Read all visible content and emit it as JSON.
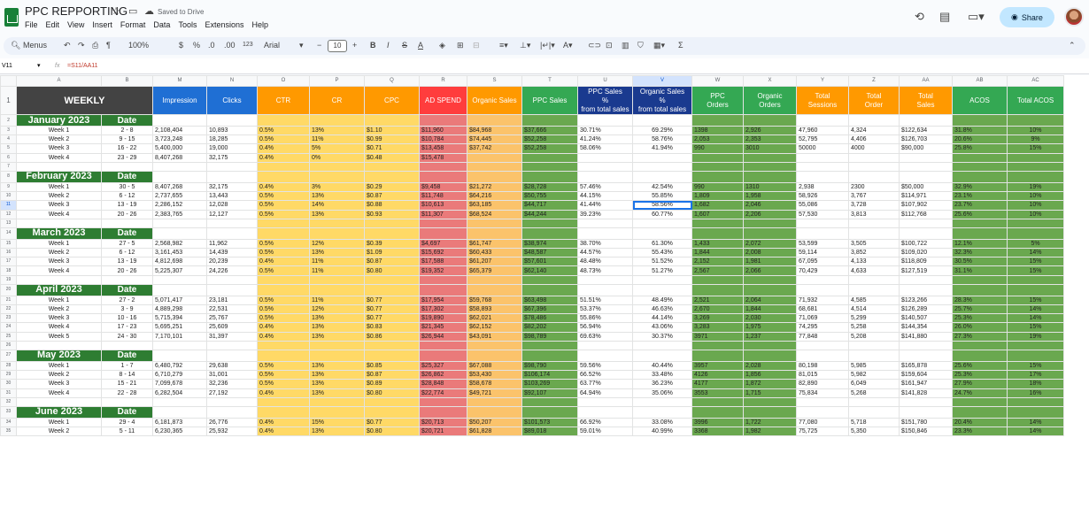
{
  "app": {
    "doc_title": "PPC REPPORTING",
    "saved_status": "Saved to Drive",
    "menus": [
      "File",
      "Edit",
      "View",
      "Insert",
      "Format",
      "Data",
      "Tools",
      "Extensions",
      "Help"
    ],
    "share_label": "Share"
  },
  "toolbar": {
    "menus_label": "Menus",
    "zoom": "100%",
    "currency": "$",
    "percent": "%",
    "decimal_dec": ".0",
    "decimal_inc": ".00",
    "number_format": "123",
    "font": "Arial",
    "font_size": "10"
  },
  "formula_bar": {
    "cell_ref": "V11",
    "fx": "fx",
    "formula": "=S11/AA11"
  },
  "columns": [
    "A",
    "B",
    "M",
    "N",
    "O",
    "P",
    "Q",
    "R",
    "S",
    "T",
    "U",
    "V",
    "W",
    "X",
    "Y",
    "Z",
    "AA",
    "AB",
    "AC"
  ],
  "selected_column": "V",
  "header_row": {
    "row_number": "1",
    "cells": [
      "WEEKLY",
      "",
      "Impression",
      "Clicks",
      "CTR",
      "CR",
      "CPC",
      "AD SPEND",
      "Organic Sales",
      "PPC Sales",
      "PPC Sales\n%\nfrom total sales",
      "Organic Sales\n%\nfrom total sales",
      "PPC\nOrders",
      "Organic\nOrders",
      "Total\nSessions",
      "Total\nOrder",
      "Total\nSales",
      "ACOS",
      "Total ACOS"
    ]
  },
  "colors": {
    "header_dark": "#434343",
    "header_blue": "#1f6fd4",
    "header_orange": "#ff9900",
    "header_red": "#ff3d3d",
    "header_green": "#34a853",
    "header_navy": "#1a3a8f",
    "month_green": "#2e7d32",
    "col_yellow": "#ffd966",
    "col_pink": "#ea7a7a",
    "col_light_orange": "#fbc36b",
    "col_green": "#6aa84f",
    "selected": "#d3e3fd"
  },
  "rows": [
    {
      "n": "2",
      "type": "month",
      "name": "January 2023",
      "date_label": "Date"
    },
    {
      "n": "3",
      "cells": [
        "Week 1",
        "2 - 8",
        "2,108,404",
        "10,893",
        "0.5%",
        "13%",
        "$1.10",
        "$11,960",
        "$84,968",
        "$37,666",
        "30.71%",
        "69.29%",
        "1398",
        "2,926",
        "47,960",
        "4,324",
        "$122,634",
        "31.8%",
        "10%"
      ]
    },
    {
      "n": "4",
      "cells": [
        "Week 2",
        "9 - 15",
        "3,723,248",
        "18,285",
        "0.5%",
        "11%",
        "$0.99",
        "$10,784",
        "$74,445",
        "$52,258",
        "41.24%",
        "58.76%",
        "2,053",
        "2,353",
        "52,795",
        "4,406",
        "$126,703",
        "20.6%",
        "9%"
      ]
    },
    {
      "n": "5",
      "cells": [
        "Week 3",
        "16 - 22",
        "5,400,000",
        "19,000",
        "0.4%",
        "5%",
        "$0.71",
        "$13,458",
        "$37,742",
        "$52,258",
        "58.06%",
        "41.94%",
        "990",
        "3010",
        "50000",
        "4000",
        "$90,000",
        "25.8%",
        "15%"
      ]
    },
    {
      "n": "6",
      "cells": [
        "Week 4",
        "23 - 29",
        "8,407,268",
        "32,175",
        "0.4%",
        "0%",
        "$0.48",
        "$15,478",
        "",
        "",
        "",
        "",
        "",
        "",
        "",
        "",
        "",
        "",
        ""
      ]
    },
    {
      "n": "7",
      "type": "blank"
    },
    {
      "n": "8",
      "type": "month",
      "name": "February 2023",
      "date_label": "Date"
    },
    {
      "n": "9",
      "cells": [
        "Week 1",
        "30 - 5",
        "8,407,268",
        "32,175",
        "0.4%",
        "3%",
        "$0.29",
        "$9,458",
        "$21,272",
        "$28,728",
        "57.46%",
        "42.54%",
        "990",
        "1310",
        "2,938",
        "2300",
        "$50,000",
        "32.9%",
        "19%"
      ]
    },
    {
      "n": "10",
      "cells": [
        "Week 2",
        "6 - 12",
        "2,737,655",
        "13,443",
        "0.5%",
        "13%",
        "$0.87",
        "$11,748",
        "$64,216",
        "$50,755",
        "44.15%",
        "55.85%",
        "1,809",
        "1,958",
        "58,926",
        "3,767",
        "$114,971",
        "23.1%",
        "10%"
      ]
    },
    {
      "n": "11",
      "cells": [
        "Week 3",
        "13 - 19",
        "2,286,152",
        "12,028",
        "0.5%",
        "14%",
        "$0.88",
        "$10,613",
        "$63,185",
        "$44,717",
        "41.44%",
        "58.56%",
        "1,682",
        "2,046",
        "55,086",
        "3,728",
        "$107,902",
        "23.7%",
        "10%"
      ]
    },
    {
      "n": "12",
      "cells": [
        "Week 4",
        "20 - 26",
        "2,383,765",
        "12,127",
        "0.5%",
        "13%",
        "$0.93",
        "$11,307",
        "$68,524",
        "$44,244",
        "39.23%",
        "60.77%",
        "1,607",
        "2,206",
        "57,530",
        "3,813",
        "$112,768",
        "25.6%",
        "10%"
      ]
    },
    {
      "n": "13",
      "type": "blank"
    },
    {
      "n": "14",
      "type": "month",
      "name": "March 2023",
      "date_label": "Date"
    },
    {
      "n": "15",
      "cells": [
        "Week 1",
        "27 - 5",
        "2,568,982",
        "11,962",
        "0.5%",
        "12%",
        "$0.39",
        "$4,697",
        "$61,747",
        "$38,974",
        "38.70%",
        "61.30%",
        "1,433",
        "2,072",
        "53,599",
        "3,505",
        "$100,722",
        "12.1%",
        "5%"
      ]
    },
    {
      "n": "16",
      "cells": [
        "Week 2",
        "6 - 12",
        "3,161,453",
        "14,439",
        "0.5%",
        "13%",
        "$1.09",
        "$15,692",
        "$60,433",
        "$48,587",
        "44.57%",
        "55.43%",
        "1,844",
        "2,008",
        "59,114",
        "3,852",
        "$109,020",
        "32.3%",
        "14%"
      ]
    },
    {
      "n": "17",
      "cells": [
        "Week 3",
        "13 - 19",
        "4,812,698",
        "20,239",
        "0.4%",
        "11%",
        "$0.87",
        "$17,588",
        "$61,207",
        "$57,601",
        "48.48%",
        "51.52%",
        "2,152",
        "1,981",
        "67,095",
        "4,133",
        "$118,809",
        "30.5%",
        "15%"
      ]
    },
    {
      "n": "18",
      "cells": [
        "Week 4",
        "20 - 26",
        "5,225,307",
        "24,226",
        "0.5%",
        "11%",
        "$0.80",
        "$19,352",
        "$65,379",
        "$62,140",
        "48.73%",
        "51.27%",
        "2,567",
        "2,066",
        "70,429",
        "4,633",
        "$127,519",
        "31.1%",
        "15%"
      ]
    },
    {
      "n": "19",
      "type": "blank"
    },
    {
      "n": "20",
      "type": "month",
      "name": "April 2023",
      "date_label": "Date"
    },
    {
      "n": "21",
      "cells": [
        "Week 1",
        "27 - 2",
        "5,071,417",
        "23,181",
        "0.5%",
        "11%",
        "$0.77",
        "$17,954",
        "$59,768",
        "$63,498",
        "51.51%",
        "48.49%",
        "2,521",
        "2,064",
        "71,932",
        "4,585",
        "$123,266",
        "28.3%",
        "15%"
      ]
    },
    {
      "n": "22",
      "cells": [
        "Week 2",
        "3 - 9",
        "4,889,298",
        "22,531",
        "0.5%",
        "12%",
        "$0.77",
        "$17,302",
        "$58,893",
        "$67,396",
        "53.37%",
        "46.63%",
        "2,670",
        "1,844",
        "68,681",
        "4,514",
        "$126,289",
        "25.7%",
        "14%"
      ]
    },
    {
      "n": "23",
      "cells": [
        "Week 3",
        "10 - 16",
        "5,715,394",
        "25,767",
        "0.5%",
        "13%",
        "$0.77",
        "$19,890",
        "$62,021",
        "$78,486",
        "55.86%",
        "44.14%",
        "3,269",
        "2,030",
        "71,069",
        "5,299",
        "$140,507",
        "25.3%",
        "14%"
      ]
    },
    {
      "n": "24",
      "cells": [
        "Week 4",
        "17 - 23",
        "5,695,251",
        "25,609",
        "0.4%",
        "13%",
        "$0.83",
        "$21,345",
        "$62,152",
        "$82,202",
        "56.94%",
        "43.06%",
        "3,283",
        "1,975",
        "74,295",
        "5,258",
        "$144,354",
        "26.0%",
        "15%"
      ]
    },
    {
      "n": "25",
      "cells": [
        "Week 5",
        "24 - 30",
        "7,170,101",
        "31,397",
        "0.4%",
        "13%",
        "$0.86",
        "$26,944",
        "$43,091",
        "$98,789",
        "69.63%",
        "30.37%",
        "3971",
        "1,237",
        "77,848",
        "5,208",
        "$141,880",
        "27.3%",
        "19%"
      ]
    },
    {
      "n": "26",
      "type": "blank"
    },
    {
      "n": "27",
      "type": "month",
      "name": "May 2023",
      "date_label": "Date"
    },
    {
      "n": "28",
      "cells": [
        "Week 1",
        "1 - 7",
        "6,480,792",
        "29,638",
        "0.5%",
        "13%",
        "$0.85",
        "$25,327",
        "$67,088",
        "$98,790",
        "59.56%",
        "40.44%",
        "3957",
        "2,028",
        "80,198",
        "5,985",
        "$165,878",
        "25.6%",
        "15%"
      ]
    },
    {
      "n": "29",
      "cells": [
        "Week 2",
        "8 - 14",
        "6,710,279",
        "31,001",
        "0.5%",
        "13%",
        "$0.87",
        "$26,862",
        "$53,430",
        "$106,174",
        "66.52%",
        "33.48%",
        "4126",
        "1,856",
        "81,015",
        "5,982",
        "$159,604",
        "25.3%",
        "17%"
      ]
    },
    {
      "n": "30",
      "cells": [
        "Week 3",
        "15 - 21",
        "7,099,678",
        "32,236",
        "0.5%",
        "13%",
        "$0.89",
        "$28,848",
        "$58,678",
        "$103,269",
        "63.77%",
        "36.23%",
        "4177",
        "1,872",
        "82,890",
        "6,049",
        "$161,947",
        "27.9%",
        "18%"
      ]
    },
    {
      "n": "31",
      "cells": [
        "Week 4",
        "22 - 28",
        "6,282,504",
        "27,192",
        "0.4%",
        "13%",
        "$0.80",
        "$22,774",
        "$49,721",
        "$92,107",
        "64.94%",
        "35.06%",
        "3553",
        "1,715",
        "75,834",
        "5,268",
        "$141,828",
        "24.7%",
        "16%"
      ]
    },
    {
      "n": "32",
      "type": "blank"
    },
    {
      "n": "33",
      "type": "month",
      "name": "June 2023",
      "date_label": "Date"
    },
    {
      "n": "34",
      "cells": [
        "Week 1",
        "29 - 4",
        "6,181,873",
        "26,776",
        "0.4%",
        "15%",
        "$0.77",
        "$20,713",
        "$50,207",
        "$101,573",
        "66.92%",
        "33.08%",
        "3996",
        "1,722",
        "77,080",
        "5,718",
        "$151,780",
        "20.4%",
        "14%"
      ]
    },
    {
      "n": "35",
      "cells": [
        "Week 2",
        "5 - 11",
        "6,230,365",
        "25,932",
        "0.4%",
        "13%",
        "$0.80",
        "$20,721",
        "$61,828",
        "$89,018",
        "59.01%",
        "40.99%",
        "3368",
        "1,982",
        "75,725",
        "5,350",
        "$150,846",
        "23.3%",
        "14%"
      ]
    }
  ]
}
